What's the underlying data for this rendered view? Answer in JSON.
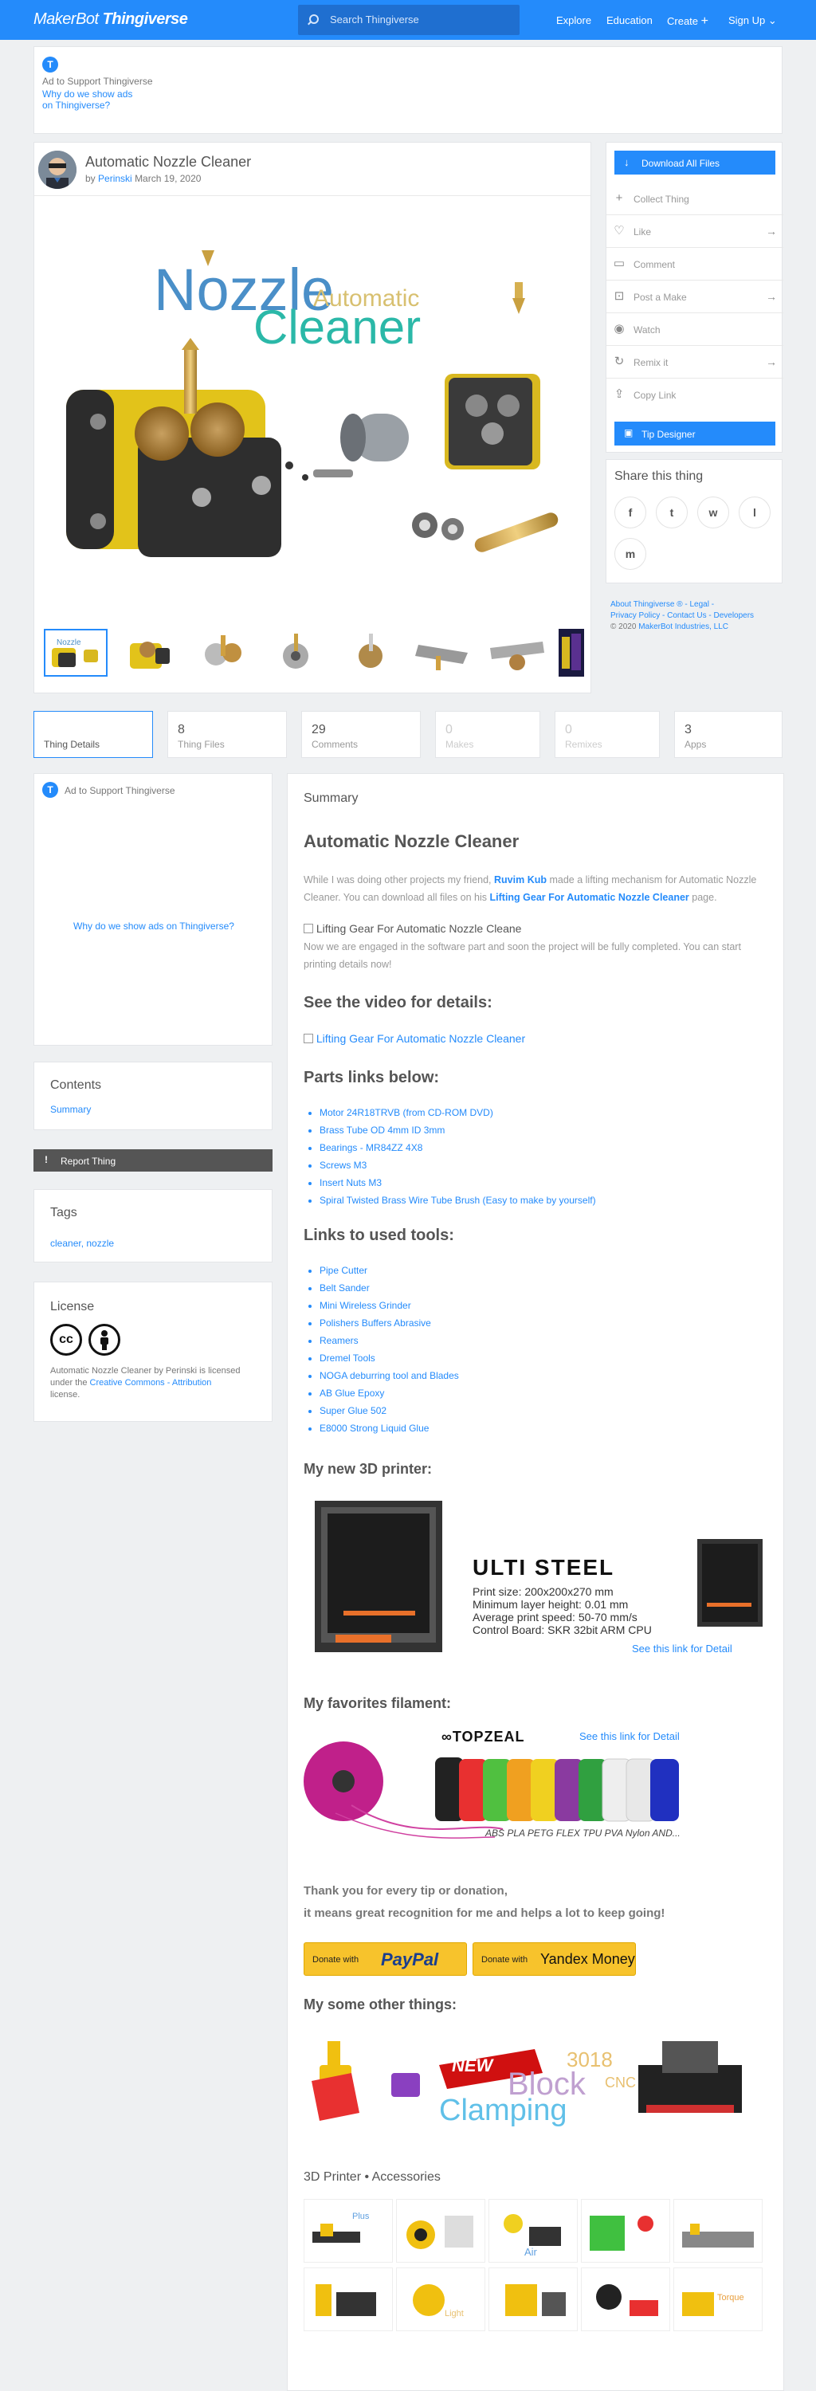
{
  "header": {
    "logo_makerbot": "MakerBot",
    "logo_thingiverse": "Thingiverse",
    "search_placeholder": "Search Thingiverse",
    "nav": [
      "Explore",
      "Education",
      "Create",
      "Sign Up"
    ],
    "brand_color": "#248bfb"
  },
  "ad_top": {
    "badge": "T",
    "text": "Ad to Support Thingiverse",
    "why_line1": "Why do we show ads",
    "why_line2": "on Thingiverse?"
  },
  "thing": {
    "title": "Automatic Nozzle Cleaner",
    "by": "by",
    "author": "Perinski",
    "date": "March 19, 2020",
    "hero_title_1": "Nozzle",
    "hero_title_2": "Automatic",
    "hero_title_3": "Cleaner"
  },
  "actions": {
    "download": "Download All Files",
    "collect": "Collect Thing",
    "like": "Like",
    "comment": "Comment",
    "post_make": "Post a Make",
    "watch": "Watch",
    "remix": "Remix it",
    "copy_link": "Copy Link",
    "tip": "Tip Designer"
  },
  "share": {
    "title": "Share this thing",
    "icons": [
      "f",
      "t",
      "w",
      "l",
      "m"
    ]
  },
  "footer_links": {
    "line1": "About Thingiverse ® - Legal -",
    "line2": "Privacy Policy - Contact Us - Developers",
    "copy": "© 2020",
    "company": "MakerBot Industries, LLC"
  },
  "tabs": [
    {
      "num": "",
      "label": "Thing Details"
    },
    {
      "num": "8",
      "label": "Thing Files"
    },
    {
      "num": "29",
      "label": "Comments"
    },
    {
      "num": "0",
      "label": "Makes"
    },
    {
      "num": "0",
      "label": "Remixes"
    },
    {
      "num": "3",
      "label": "Apps"
    }
  ],
  "left_ad": {
    "badge": "T",
    "text": "Ad to Support Thingiverse",
    "why": "Why do we show ads on Thingiverse?"
  },
  "contents": {
    "title": "Contents",
    "item": "Summary"
  },
  "report": "Report Thing",
  "tags": {
    "title": "Tags",
    "values": "cleaner, nozzle"
  },
  "license": {
    "title": "License",
    "icon1": "cc",
    "text1": "Automatic Nozzle Cleaner by Perinski is licensed under the",
    "link": "Creative Commons - Attribution",
    "text2": "license."
  },
  "summary": {
    "label": "Summary",
    "title": "Automatic Nozzle Cleaner",
    "p1a": "While I was doing other projects my friend,",
    "p1_link1": "Ruvim Kub",
    "p1b": "made a lifting mechanism for Automatic Nozzle Cleaner. You can download all files on his",
    "p1_link2": "Lifting Gear For Automatic Nozzle Cleaner",
    "p1c": "page.",
    "img_alt1": "Lifting Gear For Automatic Nozzle Cleane",
    "p2": "Now we are engaged in the software part and soon the project will be fully completed. You can start printing details now!",
    "video_heading": "See the video for details:",
    "img_alt2": "Lifting Gear For Automatic Nozzle Cleaner",
    "parts_heading": "Parts links below:",
    "parts": [
      "Motor 24R18TRVB (from CD-ROM DVD)",
      "Brass Tube OD 4mm ID 3mm",
      "Bearings - MR84ZZ 4X8",
      "Screws M3",
      "Insert Nuts M3",
      "Spiral Twisted Brass Wire Tube Brush (Easy to make by yourself)"
    ],
    "tools_heading": "Links to used tools:",
    "tools": [
      "Pipe Cutter",
      "Belt Sander",
      "Mini Wireless Grinder",
      "Polishers Buffers Abrasive",
      "Reamers",
      "Dremel Tools",
      "NOGA deburring tool and Blades",
      "AB Glue Epoxy",
      "Super Glue 502",
      "E8000 Strong Liquid Glue"
    ],
    "printer_heading": "My new 3D printer:",
    "printer": {
      "name": "ULTI STEEL",
      "spec1": "Print size: 200x200x270 mm",
      "spec2": "Minimum layer height: 0.01 mm",
      "spec3": "Average print speed: 50-70 mm/s",
      "spec4": "Control Board: SKR 32bit ARM CPU",
      "link": "See this link for Detail"
    },
    "filament_heading": "My favorites filament:",
    "filament": {
      "brand": "TOPZEAL",
      "link": "See this link for Detail",
      "types": "ABS PLA PETG FLEX TPU PVA Nylon AND..."
    },
    "thanks1": "Thank you for every tip or donation,",
    "thanks2": "it means great recognition for me and helps a lot to keep going!",
    "donate_paypal_pre": "Donate with",
    "donate_paypal": "PayPal",
    "donate_yandex_pre": "Donate with",
    "donate_yandex": "Yandex Money",
    "other_heading": "My some other things:",
    "other_banner": {
      "new": "NEW",
      "num": "3018",
      "word1": "Block",
      "word2": "Clamping",
      "cnc": "CNC"
    },
    "accessories_heading": "3D Printer • Accessories"
  }
}
